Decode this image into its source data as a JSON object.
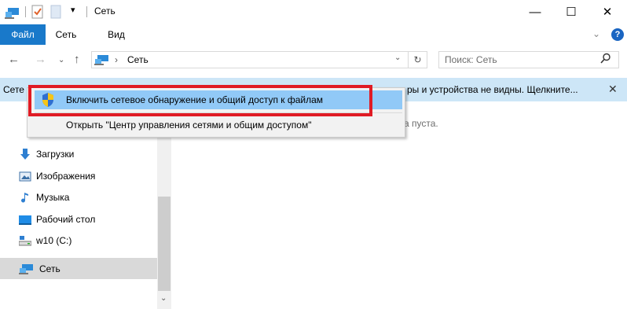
{
  "window": {
    "title": "Сеть",
    "minimize": "—",
    "maximize": "☐",
    "close": "✕"
  },
  "ribbon": {
    "tabs": [
      "Файл",
      "Сеть",
      "Вид"
    ],
    "help": "?"
  },
  "address": {
    "path": "Сеть",
    "separator": "›"
  },
  "search": {
    "placeholder": "Поиск: Сеть"
  },
  "infobar": {
    "left_text": "Сете",
    "right_text": "ры и устройства не видны. Щелкните...",
    "close": "✕"
  },
  "sidebar": {
    "items": [
      {
        "label": "Загрузки",
        "icon": "download-arrow-icon"
      },
      {
        "label": "Изображения",
        "icon": "pictures-icon"
      },
      {
        "label": "Музыка",
        "icon": "music-note-icon"
      },
      {
        "label": "Рабочий стол",
        "icon": "desktop-icon"
      },
      {
        "label": "w10 (C:)",
        "icon": "drive-icon"
      },
      {
        "label": "Сеть",
        "icon": "network-icon"
      }
    ]
  },
  "main": {
    "empty_text": "а пуста."
  },
  "context_menu": {
    "items": [
      {
        "label": "Включить сетевое обнаружение и общий доступ к файлам",
        "icon": "uac-shield-icon"
      },
      {
        "label": "Открыть \"Центр управления сетями и общим доступом\""
      }
    ]
  },
  "colors": {
    "file_tab": "#1979ca",
    "infobar": "#cde6f7",
    "menu_highlight": "#91c9f7",
    "annotation": "#e01b24"
  }
}
